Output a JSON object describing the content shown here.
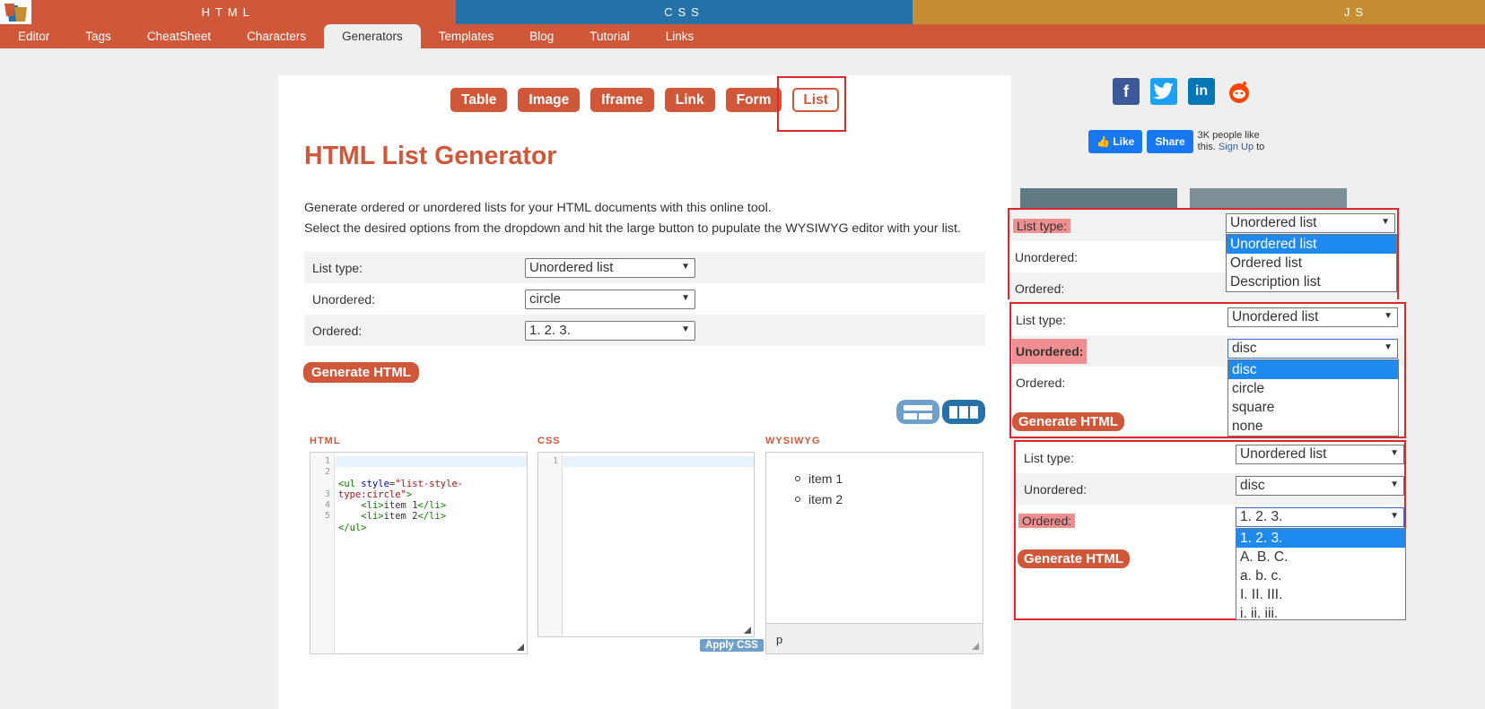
{
  "top_langs": {
    "html": "HTML",
    "css": "CSS",
    "js": "JS"
  },
  "nav": [
    "Editor",
    "Tags",
    "CheatSheet",
    "Characters",
    "Generators",
    "Templates",
    "Blog",
    "Tutorial",
    "Links"
  ],
  "nav_active": "Generators",
  "gen_tabs": [
    "Table",
    "Image",
    "Iframe",
    "Link",
    "Form",
    "List"
  ],
  "gen_tab_active": "List",
  "title": "HTML List Generator",
  "desc_line1": "Generate ordered or unordered lists for your HTML documents with this online tool.",
  "desc_line2": "Select the desired options from the dropdown and hit the large button to pupulate the WYSIWYG editor with your list.",
  "options": {
    "list_type_label": "List type:",
    "list_type_value": "Unordered list",
    "unordered_label": "Unordered:",
    "unordered_value": "circle",
    "ordered_label": "Ordered:",
    "ordered_value": "1. 2. 3."
  },
  "generate_label": "Generate HTML",
  "panels": {
    "html": "HTML",
    "css": "CSS",
    "wysiwyg": "WYSIWYG"
  },
  "code_lines": [
    "1",
    "2",
    "3",
    "4",
    "5"
  ],
  "css_lines": [
    "1"
  ],
  "apply_css": "Apply CSS",
  "wysiwyg_items": [
    "item 1",
    "item 2"
  ],
  "wysiwyg_status": "p",
  "facebook": {
    "like": "Like",
    "share": "Share",
    "text_a": "3K people like this.",
    "signup": "Sign Up",
    "text_b": "to"
  },
  "demo1": {
    "list_type_label": "List type:",
    "unordered_label": "Unordered:",
    "ordered_label": "Ordered:",
    "selected": "Unordered list",
    "options": [
      "Unordered list",
      "Ordered list",
      "Description list"
    ]
  },
  "demo2": {
    "list_type_label": "List type:",
    "list_type_value": "Unordered list",
    "unordered_label": "Unordered:",
    "ordered_label": "Ordered:",
    "selected": "disc",
    "options": [
      "disc",
      "circle",
      "square",
      "none"
    ],
    "generate": "Generate HTML"
  },
  "demo3": {
    "list_type_label": "List type:",
    "list_type_value": "Unordered list",
    "unordered_label": "Unordered:",
    "unordered_value": "disc",
    "ordered_label": "Ordered:",
    "selected": "1. 2. 3.",
    "options": [
      "1. 2. 3.",
      "A. B. C.",
      "a. b. c.",
      "I. II. III.",
      "i. ii. iii."
    ],
    "generate": "Generate HTML"
  },
  "colors": {
    "brand_orange": "#d0583a",
    "css_blue": "#2672a8",
    "js_gold": "#c58e33",
    "highlight_red": "#e0252b"
  }
}
